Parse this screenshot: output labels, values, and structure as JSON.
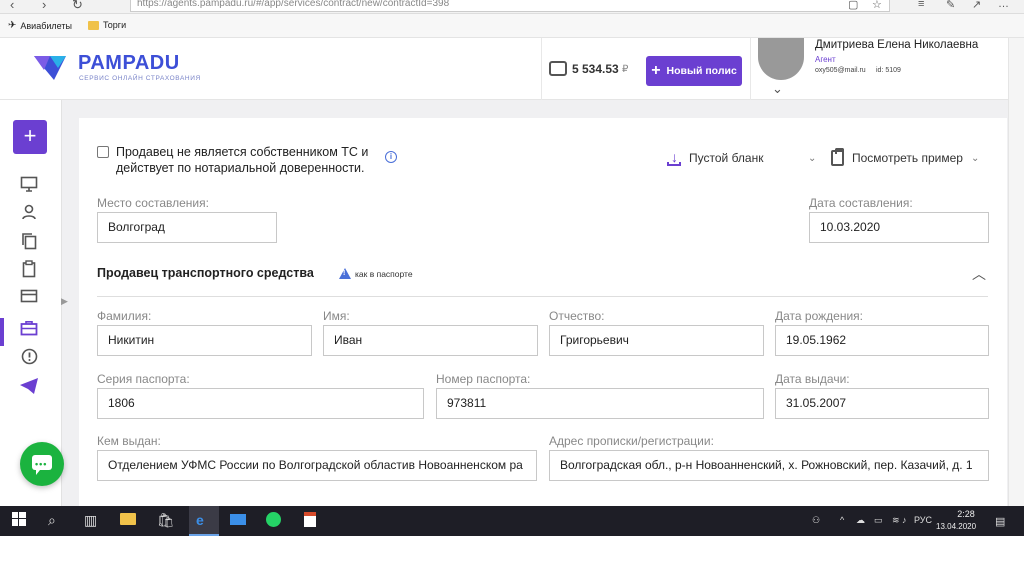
{
  "browser": {
    "url": "https://agents.pampadu.ru/#/app/services/contract/new/contractId=398",
    "bookmarks": [
      "Авиабилеты",
      "Торги"
    ]
  },
  "header": {
    "logo_text": "PAMPADU",
    "logo_sub": "СЕРВИС ОНЛАЙН СТРАХОВАНИЯ",
    "balance": "5 534.53",
    "currency": "₽",
    "new_policy_label": "Новый полис",
    "user": {
      "name": "Дмитриева Елена Николаевна",
      "role": "Агент",
      "email": "oxy505@mail.ru",
      "id": "id: 5109"
    }
  },
  "form": {
    "not_owner_checkbox_label": "Продавец не является собственником ТС и действует по нотариальной доверенности.",
    "empty_form_label": "Пустой бланк",
    "view_example_label": "Посмотреть пример",
    "place_label": "Место составления:",
    "place_value": "Волгоград",
    "date_label": "Дата составления:",
    "date_value": "10.03.2020",
    "section_title": "Продавец транспортного средства",
    "as_in_passport": "как в паспорте",
    "surname_label": "Фамилия:",
    "surname_value": "Никитин",
    "name_label": "Имя:",
    "name_value": "Иван",
    "patronymic_label": "Отчество:",
    "patronymic_value": "Григорьевич",
    "birthdate_label": "Дата рождения:",
    "birthdate_value": "19.05.1962",
    "passport_series_label": "Серия паспорта:",
    "passport_series_value": "1806",
    "passport_number_label": "Номер паспорта:",
    "passport_number_value": "973811",
    "issue_date_label": "Дата выдачи:",
    "issue_date_value": "31.05.2007",
    "issued_by_label": "Кем выдан:",
    "issued_by_value": "Отделением УФМС России по Волгоградской областив Новоанненском ра",
    "address_label": "Адрес прописки/регистрации:",
    "address_value": "Волгоградская обл., р-н Новоанненский, х. Рожновский, пер. Казачий, д. 1"
  },
  "taskbar": {
    "language": "РУС",
    "time": "2:28",
    "date": "13.04.2020"
  },
  "colors": {
    "accent": "#6b3fd1",
    "chat": "#1bb33f",
    "logo": "#3d4fd7"
  }
}
